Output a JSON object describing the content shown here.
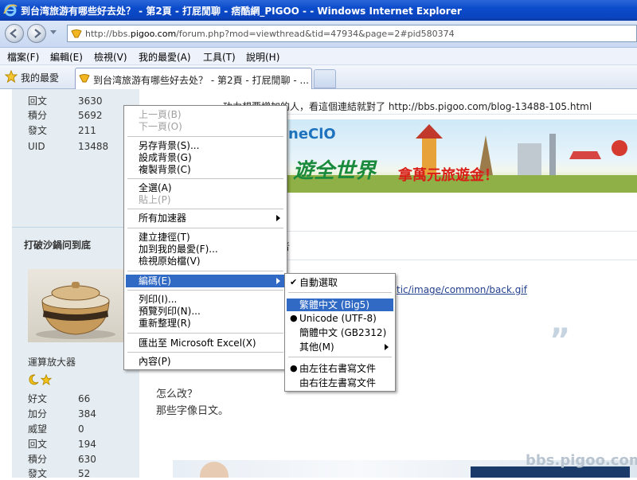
{
  "window": {
    "title": "到台湾旅游有哪些好去处？ - 第2頁 - 打屁閒聊 - 痞酷網_PIGOO - - Windows Internet Explorer"
  },
  "address": {
    "url_prefix": "http://bbs.",
    "url_host": "pigoo.com",
    "url_rest": "/forum.php?mod=viewthread&tid=47934&page=2#pid580374"
  },
  "menubar": [
    "檔案(F)",
    "編輯(E)",
    "檢視(V)",
    "我的最愛(A)",
    "工具(T)",
    "說明(H)"
  ],
  "favbar": {
    "favorites_label": "我的最愛",
    "tab_title": "到台湾旅游有哪些好去处？ - 第2頁 - 打屁閒聊 - ..."
  },
  "sidebar": {
    "user1_stats": [
      {
        "label": "回文",
        "value": "3630"
      },
      {
        "label": "積分",
        "value": "5692"
      },
      {
        "label": "發文",
        "value": "211"
      },
      {
        "label": "UID",
        "value": "13488"
      }
    ],
    "user2_name": "打破沙鍋问到底",
    "user2_title": "運算放大器",
    "user2_stats": [
      {
        "label": "好文",
        "value": "66"
      },
      {
        "label": "加分",
        "value": "384"
      },
      {
        "label": "威望",
        "value": "0"
      },
      {
        "label": "回文",
        "value": "194"
      },
      {
        "label": "積分",
        "value": "630"
      },
      {
        "label": "發文",
        "value": "52"
      }
    ]
  },
  "post": {
    "top_line": "功力想要增加的人，看這個連結就對了 http://bbs.pigoo.com/blog-13488-105.html",
    "banner_brand": "neClO",
    "banner_big": "遊全世界",
    "banner_prize": "拿萬元旅遊金！",
    "author_fragment": "作者",
    "link_fragment": "tic/image/common/back.gif",
    "quote_mark": "”",
    "reply_line1": "怎么改？",
    "reply_line2": "那些字像日文。"
  },
  "context_menu": {
    "items": [
      {
        "label": "上一頁(B)",
        "disabled": true
      },
      {
        "label": "下一頁(O)",
        "disabled": true
      },
      {
        "label": "另存背景(S)..."
      },
      {
        "label": "設成背景(G)"
      },
      {
        "label": "複製背景(C)"
      },
      {
        "label": "全選(A)"
      },
      {
        "label": "貼上(P)",
        "disabled": true
      },
      {
        "label": "所有加速器"
      },
      {
        "label": "建立捷徑(T)"
      },
      {
        "label": "加到我的最愛(F)..."
      },
      {
        "label": "檢視原始檔(V)"
      },
      {
        "label": "編碼(E)"
      },
      {
        "label": "列印(I)..."
      },
      {
        "label": "預覽列印(N)..."
      },
      {
        "label": "重新整理(R)"
      },
      {
        "label": "匯出至 Microsoft Excel(X)"
      },
      {
        "label": "內容(P)"
      }
    ]
  },
  "encoding_submenu": {
    "items": [
      {
        "label": "自動選取",
        "mark": "✔"
      },
      {
        "label": "繁體中文 (Big5)"
      },
      {
        "label": "Unicode (UTF-8)",
        "mark": "●"
      },
      {
        "label": "簡體中文 (GB2312)"
      },
      {
        "label": "其他(M)"
      },
      {
        "label": "由左往右書寫文件",
        "mark": "●"
      },
      {
        "label": "由右往左書寫文件"
      }
    ]
  },
  "watermark": "bbs.pigoo.com",
  "colors": {
    "titlebar": "#0a44be",
    "menu_highlight": "#316ac5",
    "sidebar_bg": "#e5edf2"
  }
}
